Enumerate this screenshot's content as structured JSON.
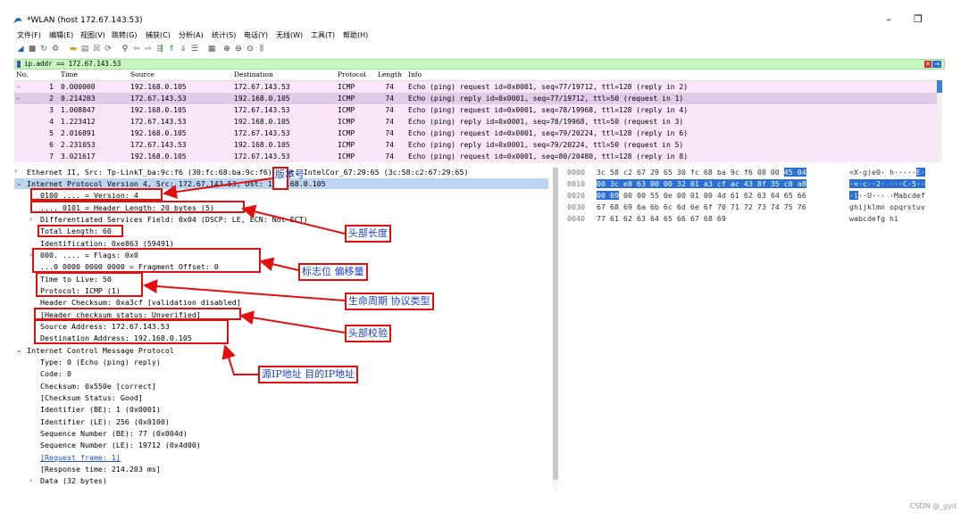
{
  "window": {
    "title": "*WLAN (host 172.67.143.53)",
    "minimize_glyph": "–",
    "restore_glyph": "❐"
  },
  "menu": [
    "文件(F)",
    "编辑(E)",
    "视图(V)",
    "跳转(G)",
    "捕获(C)",
    "分析(A)",
    "统计(S)",
    "电话(Y)",
    "无线(W)",
    "工具(T)",
    "帮助(H)"
  ],
  "toolbar_icons": [
    "shark-fin-start-icon",
    "stop-icon",
    "restart-icon",
    "options-gear-icon",
    "open-folder-icon",
    "save-file-icon",
    "close-file-icon",
    "reload-icon",
    "find-icon",
    "back-arrow-icon",
    "forward-arrow-icon",
    "goto-packet-icon",
    "first-packet-icon",
    "last-packet-icon",
    "autoscroll-icon",
    "colorize-icon",
    "zoom-in-icon",
    "zoom-out-icon",
    "zoom-normal-icon",
    "resize-columns-icon"
  ],
  "filter": {
    "value": "ip.addr == 172.67.143.53",
    "clear_glyph": "✕",
    "apply_glyph": "→"
  },
  "packet_list": {
    "headers": [
      "No.",
      "Time",
      "Source",
      "Destination",
      "Protocol",
      "Length",
      "Info"
    ],
    "rows": [
      {
        "no": "1",
        "time": "0.000000",
        "src": "192.168.0.105",
        "dst": "172.67.143.53",
        "proto": "ICMP",
        "len": "74",
        "info": "Echo (ping) request  id=0x0001, seq=77/19712, ttl=128 (reply in 2)",
        "marker": "→"
      },
      {
        "no": "2",
        "time": "0.214203",
        "src": "172.67.143.53",
        "dst": "192.168.0.105",
        "proto": "ICMP",
        "len": "74",
        "info": "Echo (ping) reply    id=0x0001, seq=77/19712, ttl=50 (request in 1)",
        "marker": "←"
      },
      {
        "no": "3",
        "time": "1.008847",
        "src": "192.168.0.105",
        "dst": "172.67.143.53",
        "proto": "ICMP",
        "len": "74",
        "info": "Echo (ping) request  id=0x0001, seq=78/19968, ttl=128 (reply in 4)",
        "marker": ""
      },
      {
        "no": "4",
        "time": "1.223412",
        "src": "172.67.143.53",
        "dst": "192.168.0.105",
        "proto": "ICMP",
        "len": "74",
        "info": "Echo (ping) reply    id=0x0001, seq=78/19968, ttl=50 (request in 3)",
        "marker": ""
      },
      {
        "no": "5",
        "time": "2.016891",
        "src": "192.168.0.105",
        "dst": "172.67.143.53",
        "proto": "ICMP",
        "len": "74",
        "info": "Echo (ping) request  id=0x0001, seq=79/20224, ttl=128 (reply in 6)",
        "marker": ""
      },
      {
        "no": "6",
        "time": "2.231053",
        "src": "172.67.143.53",
        "dst": "192.168.0.105",
        "proto": "ICMP",
        "len": "74",
        "info": "Echo (ping) reply    id=0x0001, seq=79/20224, ttl=50 (request in 5)",
        "marker": ""
      },
      {
        "no": "7",
        "time": "3.021617",
        "src": "192.168.0.105",
        "dst": "172.67.143.53",
        "proto": "ICMP",
        "len": "74",
        "info": "Echo (ping) request  id=0x0001, seq=80/20480, ttl=128 (reply in 8)",
        "marker": ""
      }
    ]
  },
  "details": {
    "ethernet": "Ethernet II, Src: Tp-LinkT_ba:9c:f6 (30:fc:68:ba:9c:f6), Dst: IntelCor_67:29:65 (3c:58:c2:67:29:65)",
    "ip_header": "Internet Protocol Version 4, Src: 172.67.143.53, Dst: 192.168.0.105",
    "ip_fields": [
      "0100 .... = Version: 4",
      ".... 0101 = Header Length: 20 bytes (5)",
      "Differentiated Services Field: 0x04 (DSCP: LE, ECN: Not-ECT)",
      "Total Length: 60",
      "Identification: 0xe863 (59491)",
      "000. .... = Flags: 0x0",
      "...0 0000 0000 0000 = Fragment Offset: 0",
      "Time to Live: 50",
      "Protocol: ICMP (1)",
      "Header Checksum: 0xa3cf [validation disabled]",
      "[Header checksum status: Unverified]",
      "Source Address: 172.67.143.53",
      "Destination Address: 192.168.0.105"
    ],
    "icmp_header": "Internet Control Message Protocol",
    "icmp_fields": [
      "Type: 0 (Echo (ping) reply)",
      "Code: 0",
      "Checksum: 0x550e [correct]",
      "[Checksum Status: Good]",
      "Identifier (BE): 1 (0x0001)",
      "Identifier (LE): 256 (0x0100)",
      "Sequence Number (BE): 77 (0x004d)",
      "Sequence Number (LE): 19712 (0x4d00)",
      "[Request frame: 1]",
      "[Response time: 214.203 ms]"
    ],
    "data": "Data (32 bytes)"
  },
  "bytes": {
    "offsets": [
      "0000",
      "0010",
      "0020",
      "0030",
      "0040"
    ],
    "lines": [
      {
        "pre": "3c 58 c2 67 29 65 30 fc  68 ba 9c f6 08 00 ",
        "hl": "45 04",
        "post": "",
        "ascii_pre": "<X·g)e0· h·····",
        "ascii_hl": "E·",
        "ascii_post": ""
      },
      {
        "pre": "",
        "hl": "00 3c e8 63 00 00 32 01  a3 cf ac 43 8f 35 c0 a8",
        "post": "",
        "ascii_pre": "",
        "ascii_hl": "·<·c··2· ···C·5··",
        "ascii_post": ""
      },
      {
        "pre": "",
        "hl": "00 69",
        "post": " 00 00 55 0e 00 01  00 4d 61 62 63 64 65 66",
        "ascii_pre": "",
        "ascii_hl": "·i",
        "ascii_post": "··U··· ·Mabcdef"
      },
      {
        "pre": "67 68 69 6a 6b 6c 6d 6e  6f 70 71 72 73 74 75 76",
        "hl": "",
        "post": "",
        "ascii_pre": "ghijklmn opqrstuv",
        "ascii_hl": "",
        "ascii_post": ""
      },
      {
        "pre": "77 61 62 63 64 65 66 67  68 69",
        "hl": "",
        "post": "",
        "ascii_pre": "wabcdefg hi",
        "ascii_hl": "",
        "ascii_post": ""
      }
    ]
  },
  "annotations": {
    "version_no": "版本号",
    "header_len": "头部长度",
    "flags_offset": "标志位   偏移量",
    "ttl_proto": "生命周期    协议类型",
    "checksum": "头部校验",
    "addresses": "源IP地址    目的IP地址"
  },
  "watermark": "CSDN @_gyd",
  "colors": {
    "filter_bg": "#c9f5c0",
    "row_bg": "#fae6f8",
    "row_selected": "#e1c9e8",
    "annotation_red": "#e01010",
    "annotation_text": "#1a40d0",
    "hex_highlight": "#2a6fd4"
  }
}
